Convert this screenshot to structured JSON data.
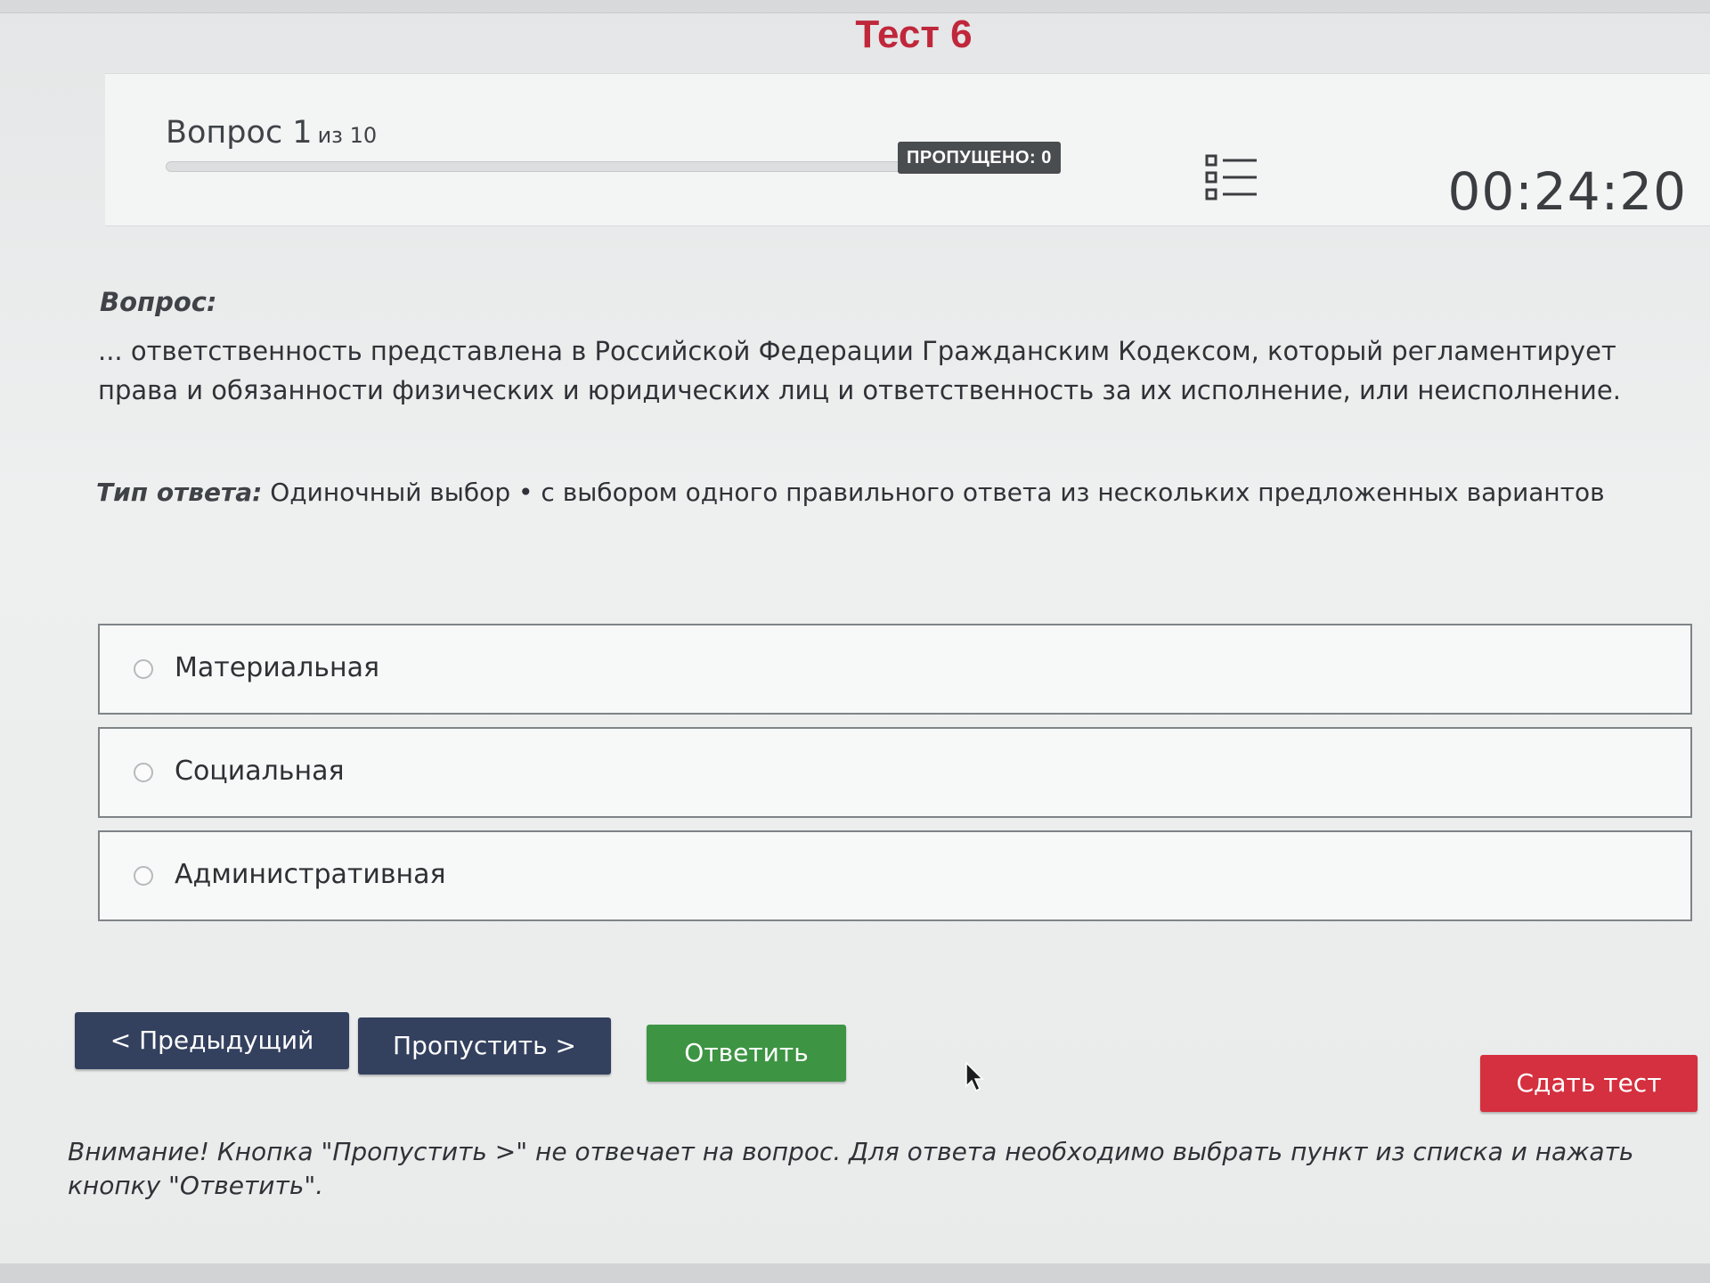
{
  "test": {
    "title": "Тест 6"
  },
  "header": {
    "question_word": "Вопрос 1",
    "question_total": "из 10",
    "progress_fraction": 0,
    "skipped_label": "ПРОПУЩЕНО: 0",
    "list_icon": "question-list-icon",
    "timer": "00:24:20"
  },
  "question": {
    "label": "Вопрос:",
    "text": "... ответственность представлена в Российской Федерации Гражданским Кодексом, который регламентирует права и обязанности физических и юридических лиц и ответственность за их исполнение, или неисполнение."
  },
  "answer_type": {
    "label": "Тип ответа:",
    "value": "Одиночный выбор • с выбором одного правильного ответа из нескольких предложенных вариантов"
  },
  "options": [
    {
      "label": "Материальная",
      "selected": false
    },
    {
      "label": "Социальная",
      "selected": false
    },
    {
      "label": "Административная",
      "selected": false
    }
  ],
  "buttons": {
    "prev": "< Предыдущий",
    "skip": "Пропустить >",
    "answer": "Ответить",
    "submit": "Сдать тест"
  },
  "warning": "Внимание! Кнопка \"Пропустить >\" не отвечает на вопрос. Для ответа необходимо выбрать пункт из списка и нажать кнопку \"Ответить\".",
  "colors": {
    "title": "#c0273b",
    "nav_button": "#33405e",
    "answer_button": "#3d9443",
    "submit_button": "#d5303f",
    "badge": "#4a4d50"
  }
}
